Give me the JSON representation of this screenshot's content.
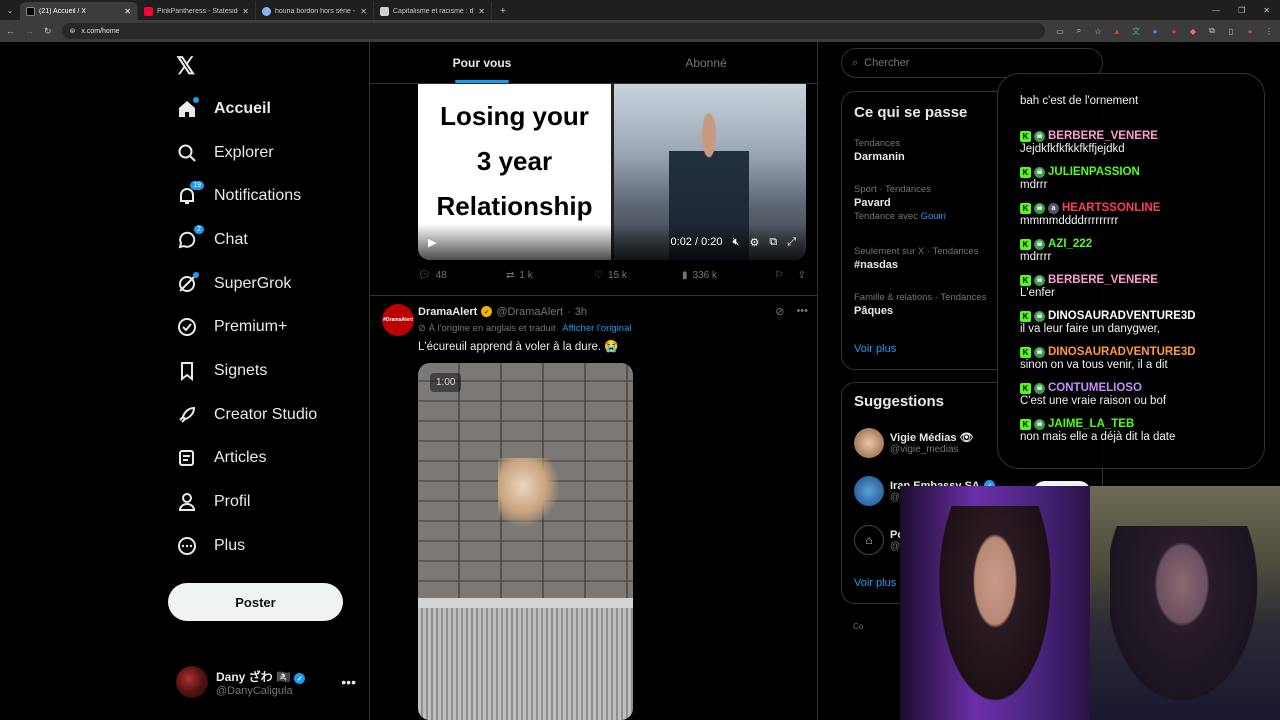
{
  "browser": {
    "tabs": [
      {
        "title": "(21) Accueil / X",
        "active": true,
        "color": "#e7e9ea"
      },
      {
        "title": "PinkPantheress - Stateside + Z...",
        "active": false,
        "color": "#ff0033"
      },
      {
        "title": "houria bordon hors série - Rech...",
        "active": false,
        "color": "#8ab4f8"
      },
      {
        "title": "Capitalisme et racisme : d'une ...",
        "active": false,
        "color": "#d0d0d0"
      }
    ],
    "url": "x.com/home"
  },
  "nav": {
    "items": [
      {
        "label": "Accueil",
        "icon": "home-icon",
        "active": true
      },
      {
        "label": "Explorer",
        "icon": "search-icon"
      },
      {
        "label": "Notifications",
        "icon": "bell-icon",
        "badge": "19"
      },
      {
        "label": "Chat",
        "icon": "chat-icon",
        "badge": "2"
      },
      {
        "label": "SuperGrok",
        "icon": "grok-icon"
      },
      {
        "label": "Premium+",
        "icon": "premium-icon"
      },
      {
        "label": "Signets",
        "icon": "bookmark-icon"
      },
      {
        "label": "Creator Studio",
        "icon": "rocket-icon"
      },
      {
        "label": "Articles",
        "icon": "article-icon"
      },
      {
        "label": "Profil",
        "icon": "person-icon"
      },
      {
        "label": "Plus",
        "icon": "more-circle-icon"
      }
    ],
    "post_label": "Poster",
    "profile": {
      "name": "Dany ざわ 🏴‍☠️",
      "handle": "@DanyCaligula"
    }
  },
  "feed": {
    "tabs": [
      "Pour vous",
      "Abonné"
    ],
    "tweet1": {
      "video_text": [
        "Losing your",
        "3 year",
        "Relationship"
      ],
      "time": "0:02 / 0:20",
      "replies": "48",
      "reposts": "1 k",
      "likes": "15 k",
      "views": "336 k"
    },
    "tweet2": {
      "name": "DramaAlert",
      "handle": "@DramaAlert",
      "time": "3h",
      "translation_note": "À l'origine en anglais et traduit",
      "translation_link": "Afficher l'original",
      "text": "L'écureuil apprend à voler à la dure. 😭",
      "video_time": "1:00",
      "avatar_text": "#DramaAlert"
    }
  },
  "sidebar": {
    "search_placeholder": "Chercher",
    "trends_title": "Ce qui se passe",
    "trends": [
      {
        "meta": "Tendances",
        "name": "Darmanin"
      },
      {
        "meta": "Sport · Tendances",
        "name": "Pavard",
        "sub": "Tendance avec",
        "sub_link": "Gouiri"
      },
      {
        "meta": "Seulement sur X · Tendances",
        "name": "#nasdas"
      },
      {
        "meta": "Famille & relations · Tendances",
        "name": "Pâques"
      }
    ],
    "see_more": "Voir plus",
    "suggestions_title": "Suggestions",
    "suggestions": [
      {
        "name": "Vigie Médias 👁",
        "handle": "@vigie_medias"
      },
      {
        "name": "Iran Embassy SA",
        "handle": "@"
      },
      {
        "name": "Po",
        "handle": "@"
      }
    ],
    "see_more2": "Voir plus",
    "footer_cut": "Co"
  },
  "chat": {
    "messages": [
      {
        "user": "",
        "color": "#53fc18",
        "text": "bah c'est de l'ornement"
      },
      {
        "user": "BERBERE_VENERE",
        "color": "#ff9bd1",
        "text": "Jejdkfkfkfkkfkffjejdkd"
      },
      {
        "user": "JULIENPASSION",
        "color": "#53fc18",
        "text": "mdrrr"
      },
      {
        "user": "HEARTSSONLINE",
        "color": "#ff3b5c",
        "text": "mmmmddddrrrrrrrrr"
      },
      {
        "user": "AZI_222",
        "color": "#53fc18",
        "text": "mdrrrr"
      },
      {
        "user": "BERBERE_VENERE",
        "color": "#ff9bd1",
        "text": "L'enfer"
      },
      {
        "user": "DINOSAURADVENTURE3D",
        "color": "#ffffff",
        "text": "il va leur faire un danygwer,"
      },
      {
        "user": "DINOSAURADVENTURE3D",
        "color": "#ff9a3c",
        "text": "sinon on va tous venir, il a dit"
      },
      {
        "user": "CONTUMELIOSO",
        "color": "#c88cff",
        "text": "C'est une vraie raison ou bof"
      },
      {
        "user": "JAIME_LA_TEB",
        "color": "#53fc18",
        "text": "non mais elle a déjà dit la date"
      }
    ]
  }
}
